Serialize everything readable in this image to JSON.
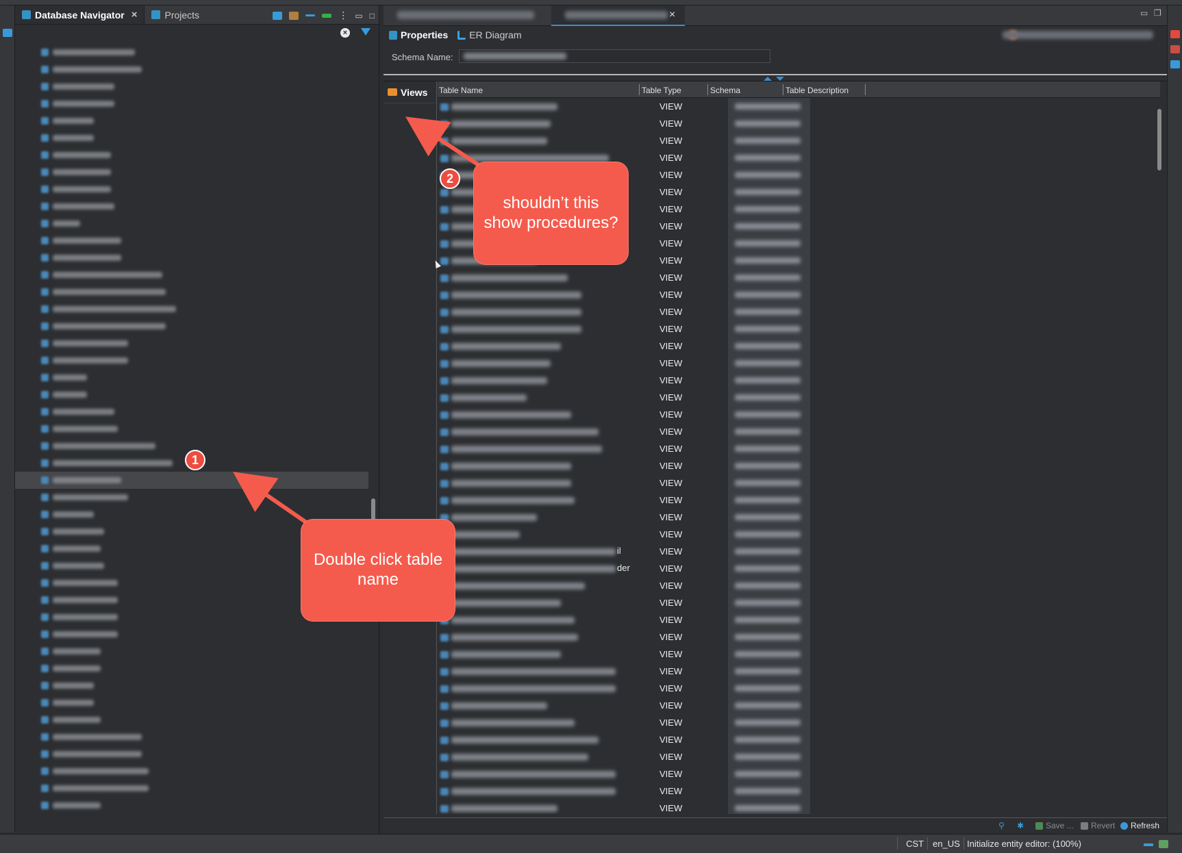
{
  "navigator": {
    "tab_active": "Database Navigator",
    "tab_inactive": "Projects",
    "close_glyph": "×",
    "clear_glyph": "×",
    "tree_label_widths": [
      120,
      130,
      90,
      90,
      60,
      60,
      85,
      85,
      85,
      90,
      40,
      100,
      100,
      160,
      165,
      180,
      165,
      110,
      110,
      50,
      50,
      90,
      95,
      150,
      175,
      100,
      110,
      60,
      75,
      70,
      75,
      95,
      95,
      95,
      95,
      70,
      70,
      60,
      60,
      70,
      130,
      130,
      140,
      140,
      70
    ],
    "selected_index": 25
  },
  "editor": {
    "close_glyph": "×",
    "subtab_properties": "Properties",
    "subtab_er": "ER Diagram",
    "schema_label": "Schema Name:",
    "left_nav_item": "Views",
    "columns": [
      "Table Name",
      "Table Type",
      "Schema",
      "Table Description"
    ],
    "row_type": "VIEW",
    "row_name_widths": [
      155,
      145,
      140,
      230,
      150,
      150,
      155,
      130,
      135,
      125,
      170,
      190,
      190,
      190,
      160,
      145,
      140,
      110,
      175,
      215,
      220,
      175,
      175,
      180,
      125,
      100,
      265,
      265,
      195,
      160,
      180,
      185,
      160,
      260,
      240,
      140,
      180,
      215,
      200,
      270,
      270,
      155
    ],
    "row_suffixes": {
      "26": "il",
      "27": "der"
    },
    "bottom_actions": [
      "Save ...",
      "Revert",
      "Refresh"
    ]
  },
  "status": {
    "timezone": "CST",
    "locale": "en_US",
    "message": "Initialize entity editor: (100%)"
  },
  "annotations": {
    "callout1_text": "Double click table name",
    "badge1": "1",
    "callout2_text": "shouldn’t this show procedures?",
    "badge2": "2"
  },
  "colors": {
    "callout": "#f45b4d",
    "accent_blue": "#3a8fd0",
    "views_icon": "#e8902f"
  }
}
